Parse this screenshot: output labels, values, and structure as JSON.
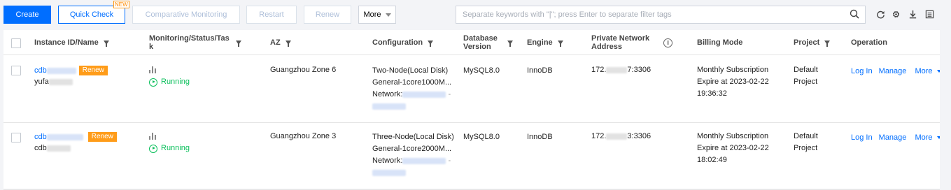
{
  "toolbar": {
    "create": "Create",
    "quick_check": "Quick Check",
    "new_badge": "NEW",
    "comparative_monitoring": "Comparative Monitoring",
    "restart": "Restart",
    "renew": "Renew",
    "more": "More",
    "search_placeholder": "Separate keywords with \"|\"; press Enter to separate filter tags"
  },
  "icons": [
    "refresh-icon",
    "gear-icon",
    "download-icon",
    "list-settings-icon"
  ],
  "colors": {
    "primary": "#006eff",
    "running": "#0abf5b",
    "renew_tag": "#ff9c19"
  },
  "columns": {
    "instance": "Instance ID/Name",
    "monitoring_1": "Monitoring/Status/Tas",
    "monitoring_2": "k",
    "az": "AZ",
    "configuration": "Configuration",
    "db_version_1": "Database",
    "db_version_2": "Version",
    "engine": "Engine",
    "network_1": "Private Network",
    "network_2": "Address",
    "billing": "Billing Mode",
    "project": "Project",
    "operation": "Operation"
  },
  "rows": [
    {
      "id_prefix": "cdb",
      "renew_tag": "Renew",
      "name_prefix": "yufa",
      "status": "Running",
      "az": "Guangzhou Zone 6",
      "config_1": "Two-Node(Local Disk)",
      "config_2": "General-1core1000M...",
      "config_3": "Network:",
      "db_version": "MySQL8.0",
      "engine": "InnoDB",
      "ip_prefix": "172.",
      "ip_suffix": "7:3306",
      "billing_1": "Monthly Subscription",
      "billing_2": "Expire at 2023-02-22",
      "billing_3": "19:36:32",
      "project_1": "Default",
      "project_2": "Project",
      "op_login": "Log In",
      "op_manage": "Manage",
      "op_more": "More"
    },
    {
      "id_prefix": "cdb",
      "renew_tag": "Renew",
      "name_prefix": "cdb",
      "status": "Running",
      "az": "Guangzhou Zone 3",
      "config_1": "Three-Node(Local Disk)",
      "config_2": "General-1core2000M...",
      "config_3": "Network:",
      "db_version": "MySQL8.0",
      "engine": "InnoDB",
      "ip_prefix": "172.",
      "ip_suffix": "3:3306",
      "billing_1": "Monthly Subscription",
      "billing_2": "Expire at 2023-02-22",
      "billing_3": "18:02:49",
      "project_1": "Default",
      "project_2": "Project",
      "op_login": "Log In",
      "op_manage": "Manage",
      "op_more": "More"
    }
  ]
}
